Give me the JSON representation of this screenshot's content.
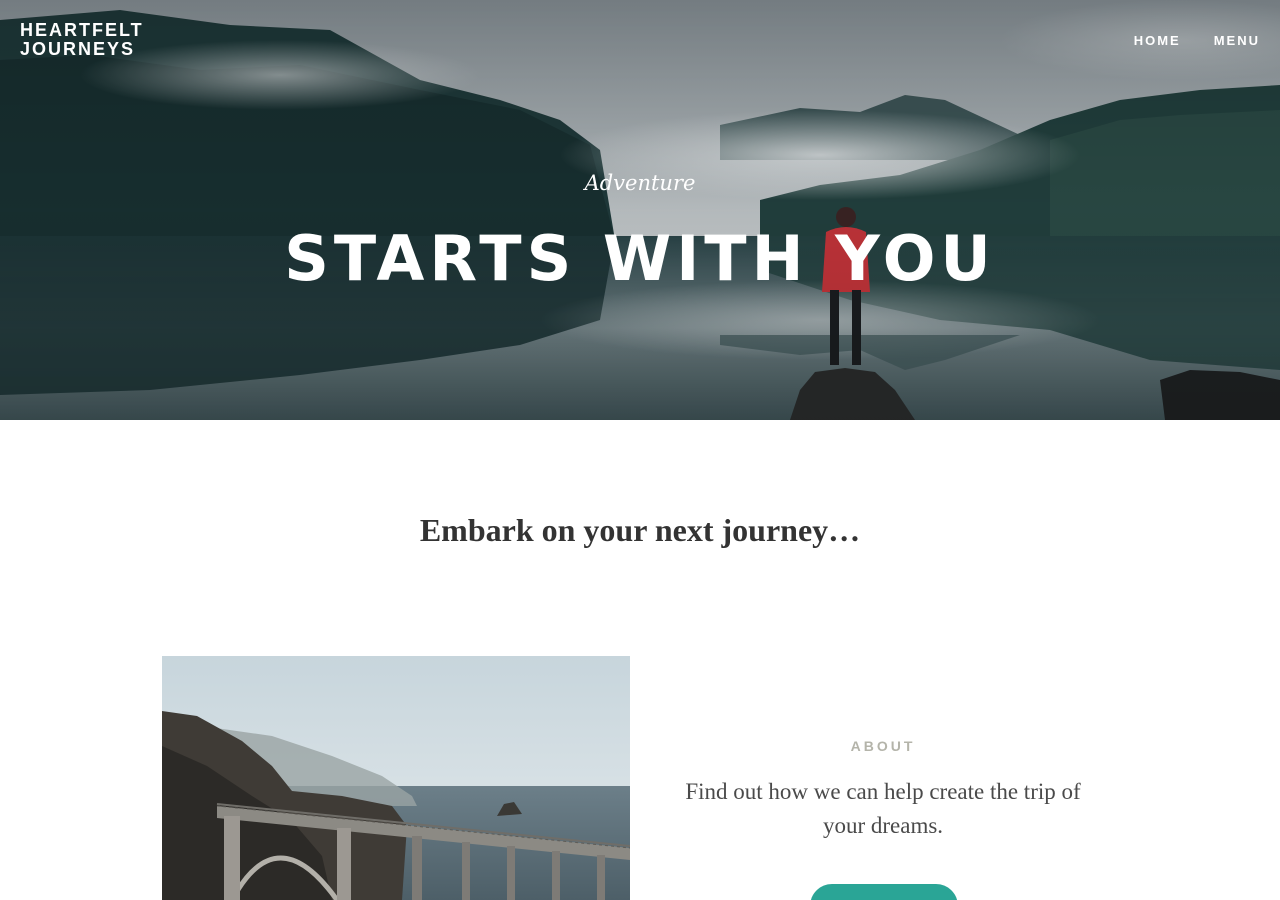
{
  "site": {
    "logo_line1": "HEARTFELT",
    "logo_line2": "JOURNEYS"
  },
  "nav": {
    "items": [
      {
        "label": "HOME"
      },
      {
        "label": "MENU"
      }
    ]
  },
  "hero": {
    "kicker": "Adventure",
    "title": "STARTS WITH YOU"
  },
  "intro": {
    "tagline": "Embark on your next journey…"
  },
  "about": {
    "label": "ABOUT",
    "text": "Find out how we can help create the trip of your dreams.",
    "button_label": ""
  },
  "colors": {
    "accent": "#2aa596",
    "label_gray": "#b4b4aa",
    "text_dark": "#333333"
  }
}
